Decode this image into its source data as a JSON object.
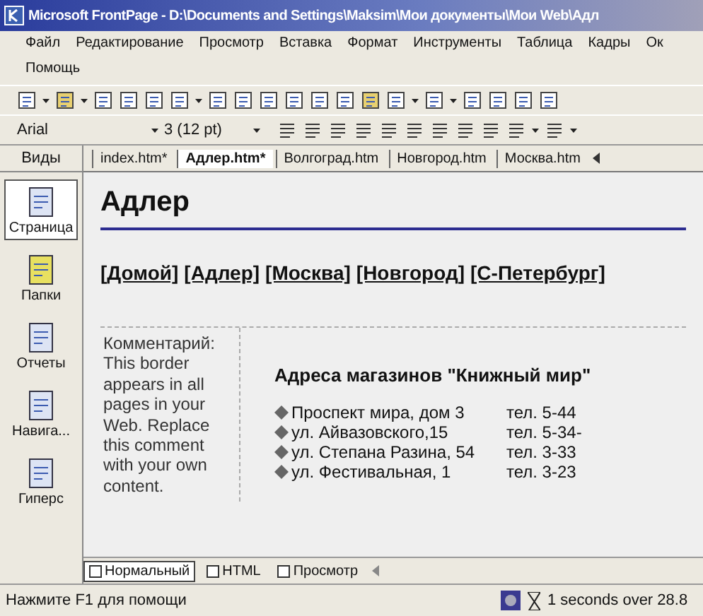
{
  "window": {
    "title": "Microsoft FrontPage - D:\\Documents and Settings\\Maksim\\Мои документы\\Мои Web\\Адл"
  },
  "menu": {
    "items": [
      "Файл",
      "Редактирование",
      "Просмотр",
      "Вставка",
      "Формат",
      "Инструменты",
      "Таблица",
      "Кадры",
      "Ок",
      "Помощь"
    ]
  },
  "format_toolbar": {
    "font": "Arial",
    "size": "3  (12 pt)"
  },
  "views": {
    "title": "Виды",
    "items": [
      {
        "label": "Страница",
        "selected": true
      },
      {
        "label": "Папки",
        "selected": false
      },
      {
        "label": "Отчеты",
        "selected": false
      },
      {
        "label": "Навига...",
        "selected": false
      },
      {
        "label": "Гиперс",
        "selected": false
      }
    ]
  },
  "doc_tabs": [
    {
      "label": "index.htm*",
      "selected": false
    },
    {
      "label": "Адлер.htm*",
      "selected": true
    },
    {
      "label": "Волгоград.htm",
      "selected": false
    },
    {
      "label": "Новгород.htm",
      "selected": false
    },
    {
      "label": "Москва.htm",
      "selected": false
    }
  ],
  "page": {
    "heading": "Адлер",
    "nav_links": [
      "[Домой]",
      "[Адлер]",
      "[Москва]",
      "[Новгород]",
      "[С-Петербург]"
    ],
    "comment": "Комментарий: This border appears in all pages in your Web. Replace this comment with your own content.",
    "stores_heading": "Адреса магазинов \"Книжный мир\"",
    "stores": [
      {
        "address": "Проспект мира, дом 3",
        "phone": "тел. 5-44"
      },
      {
        "address": "ул. Айвазовского,15",
        "phone": "тел. 5-34-"
      },
      {
        "address": "ул. Степана Разина, 54",
        "phone": "тел. 3-33"
      },
      {
        "address": "ул. Фестивальная, 1",
        "phone": "тел. 3-23"
      }
    ]
  },
  "view_tabs": [
    {
      "label": "Нормальный",
      "selected": true
    },
    {
      "label": "HTML",
      "selected": false
    },
    {
      "label": "Просмотр",
      "selected": false
    }
  ],
  "status_bar": {
    "hint": "Нажмите F1 для помощи",
    "timing": "1 seconds over 28.8"
  }
}
